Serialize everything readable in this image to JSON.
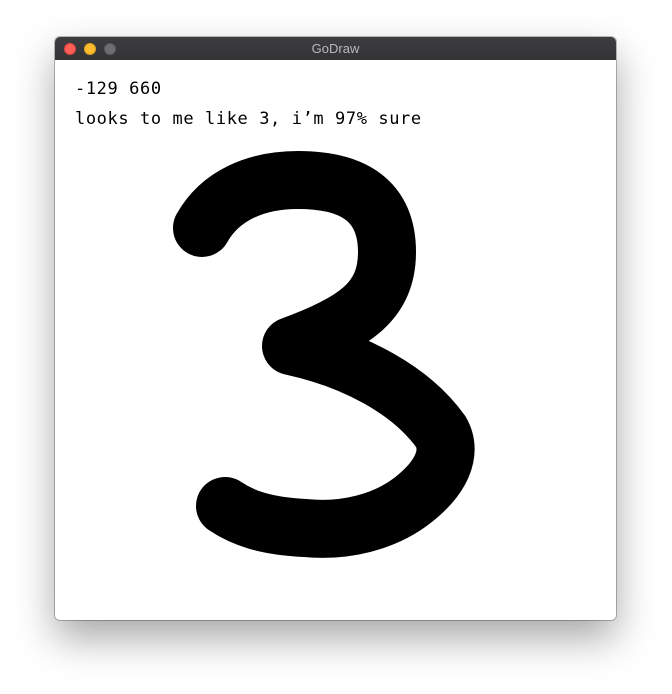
{
  "window": {
    "title": "GoDraw"
  },
  "canvas": {
    "coordinates": "-129 660",
    "prediction": "looks to me like 3, i’m 97% sure",
    "stroke_color": "#000000",
    "background_color": "#ffffff"
  },
  "icons": {
    "close": "close-dot",
    "minimize": "minimize-dot",
    "zoom": "zoom-dot"
  }
}
